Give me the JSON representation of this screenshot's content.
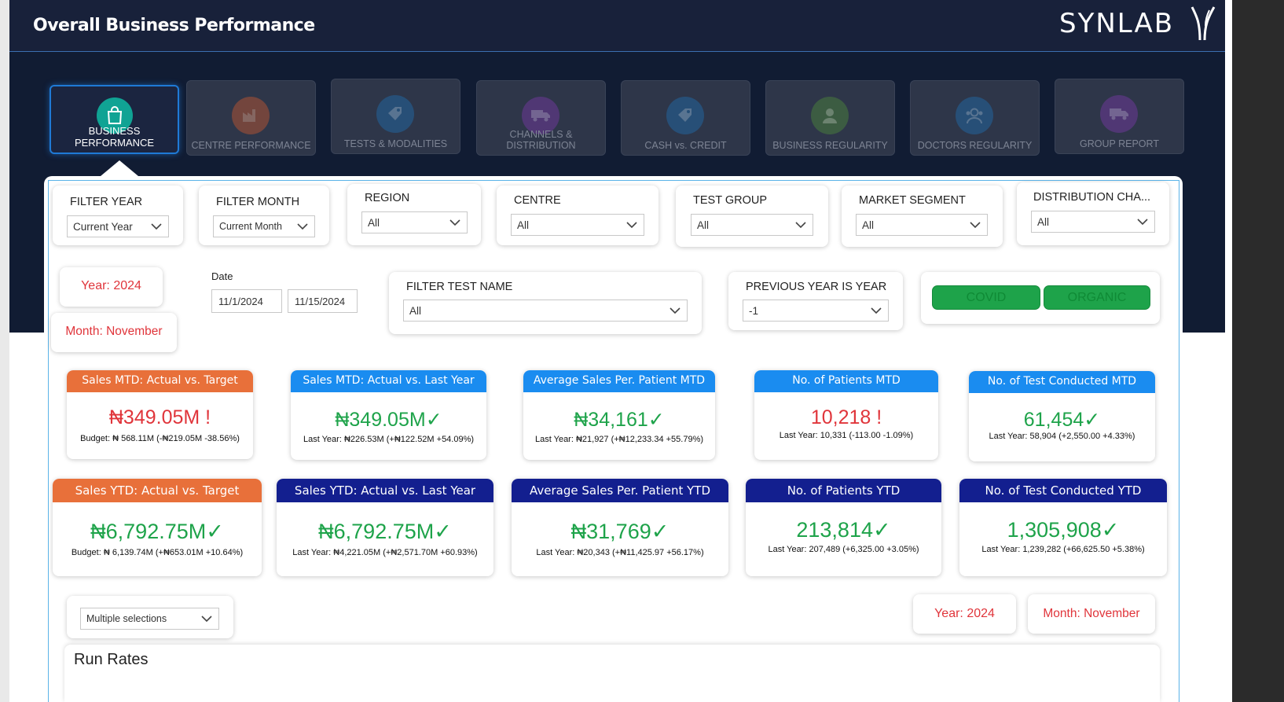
{
  "header": {
    "title": "Overall Business Performance",
    "logo": "SYNLAB"
  },
  "nav": [
    {
      "label": "BUSINESS PERFORMANCE",
      "icon": "shopping-bag-icon",
      "color": "#10a394",
      "active": true
    },
    {
      "label": "CENTRE PERFORMANCE",
      "icon": "factory-icon",
      "color": "#c8582f",
      "active": false
    },
    {
      "label": "TESTS & MODALITIES",
      "icon": "tag-icon",
      "color": "#1f6fb0",
      "active": false
    },
    {
      "label": "CHANNELS & DISTRIBUTION",
      "icon": "truck-icon",
      "color": "#7a3aa8",
      "active": false
    },
    {
      "label": "CASH vs. CREDIT",
      "icon": "tag-icon",
      "color": "#1f6fb0",
      "active": false
    },
    {
      "label": "BUSINESS REGULARITY",
      "icon": "user-icon",
      "color": "#4e8a3a",
      "active": false
    },
    {
      "label": "DOCTORS REGULARITY",
      "icon": "doctor-icon",
      "color": "#1f6fb0",
      "active": false
    },
    {
      "label": "GROUP REPORT",
      "icon": "truck-icon",
      "color": "#7a3aa8",
      "active": false
    }
  ],
  "filters": {
    "filter_year": {
      "label": "FILTER YEAR",
      "value": "Current Year"
    },
    "filter_month": {
      "label": "FILTER MONTH",
      "value": "Current Month"
    },
    "region": {
      "label": "REGION",
      "value": "All"
    },
    "centre": {
      "label": "CENTRE",
      "value": "All"
    },
    "test_group": {
      "label": "TEST GROUP",
      "value": "All"
    },
    "market_segment": {
      "label": "MARKET SEGMENT",
      "value": "All"
    },
    "distribution_channel": {
      "label": "DISTRIBUTION CHA...",
      "value": "All"
    },
    "filter_test_name": {
      "label": "FILTER TEST NAME",
      "value": "All"
    },
    "previous_year": {
      "label": "PREVIOUS YEAR IS YEAR",
      "value": "-1"
    }
  },
  "date": {
    "label": "Date",
    "start": "11/1/2024",
    "end": "11/15/2024"
  },
  "context": {
    "year": "Year: 2024",
    "month": "Month: November"
  },
  "toggles": {
    "covid": "COVID",
    "organic": "ORGANIC"
  },
  "kpis_mtd": [
    {
      "title": "Sales MTD: Actual vs. Target",
      "value": "₦349.05M",
      "mark": "!",
      "status": "bad",
      "sub": "Budget: ₦ 568.11M (-₦219.05M -38.56%)"
    },
    {
      "title": "Sales MTD: Actual vs. Last Year",
      "value": "₦349.05M",
      "mark": "✓",
      "status": "good",
      "sub": "Last Year: ₦226.53M (+₦122.52M +54.09%)"
    },
    {
      "title": "Average Sales Per. Patient MTD",
      "value": "₦34,161",
      "mark": "✓",
      "status": "good",
      "sub": "Last Year: ₦21,927 (+₦12,233.34 +55.79%)"
    },
    {
      "title": "No. of Patients MTD",
      "value": "10,218",
      "mark": "!",
      "status": "bad",
      "sub": "Last Year: 10,331 (-113.00 -1.09%)"
    },
    {
      "title": "No. of Test Conducted MTD",
      "value": "61,454",
      "mark": "✓",
      "status": "good",
      "sub": "Last Year: 58,904 (+2,550.00 +4.33%)"
    }
  ],
  "kpis_ytd": [
    {
      "title": "Sales YTD: Actual vs. Target",
      "value": "₦6,792.75M",
      "mark": "✓",
      "status": "good",
      "sub": "Budget: ₦ 6,139.74M (+₦653.01M +10.64%)"
    },
    {
      "title": "Sales YTD: Actual vs. Last Year",
      "value": "₦6,792.75M",
      "mark": "✓",
      "status": "good",
      "sub": "Last Year: ₦4,221.05M (+₦2,571.70M +60.93%)"
    },
    {
      "title": "Average Sales Per. Patient YTD",
      "value": "₦31,769",
      "mark": "✓",
      "status": "good",
      "sub": "Last Year: ₦20,343 (+₦11,425.97 +56.17%)"
    },
    {
      "title": "No. of Patients YTD",
      "value": "213,814",
      "mark": "✓",
      "status": "good",
      "sub": "Last Year: 207,489 (+6,325.00 +3.05%)"
    },
    {
      "title": "No. of Test Conducted YTD",
      "value": "1,305,908",
      "mark": "✓",
      "status": "good",
      "sub": "Last Year: 1,239,282 (+66,625.50 +5.38%)"
    }
  ],
  "bottom": {
    "selection": "Multiple selections",
    "run_rates": "Run Rates"
  }
}
